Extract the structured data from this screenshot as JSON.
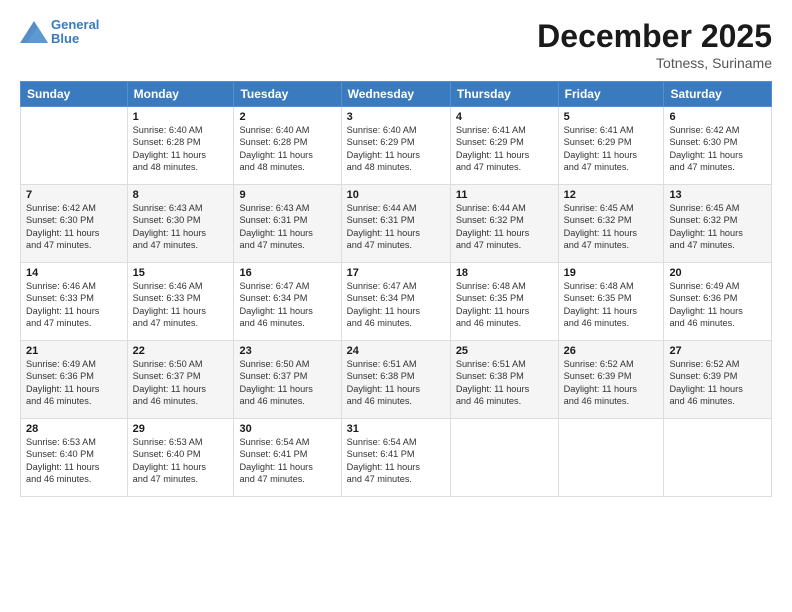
{
  "header": {
    "logo_line1": "General",
    "logo_line2": "Blue",
    "month": "December 2025",
    "location": "Totness, Suriname"
  },
  "days_of_week": [
    "Sunday",
    "Monday",
    "Tuesday",
    "Wednesday",
    "Thursday",
    "Friday",
    "Saturday"
  ],
  "weeks": [
    [
      {
        "day": "",
        "info": ""
      },
      {
        "day": "1",
        "info": "Sunrise: 6:40 AM\nSunset: 6:28 PM\nDaylight: 11 hours\nand 48 minutes."
      },
      {
        "day": "2",
        "info": "Sunrise: 6:40 AM\nSunset: 6:28 PM\nDaylight: 11 hours\nand 48 minutes."
      },
      {
        "day": "3",
        "info": "Sunrise: 6:40 AM\nSunset: 6:29 PM\nDaylight: 11 hours\nand 48 minutes."
      },
      {
        "day": "4",
        "info": "Sunrise: 6:41 AM\nSunset: 6:29 PM\nDaylight: 11 hours\nand 47 minutes."
      },
      {
        "day": "5",
        "info": "Sunrise: 6:41 AM\nSunset: 6:29 PM\nDaylight: 11 hours\nand 47 minutes."
      },
      {
        "day": "6",
        "info": "Sunrise: 6:42 AM\nSunset: 6:30 PM\nDaylight: 11 hours\nand 47 minutes."
      }
    ],
    [
      {
        "day": "7",
        "info": "Sunrise: 6:42 AM\nSunset: 6:30 PM\nDaylight: 11 hours\nand 47 minutes."
      },
      {
        "day": "8",
        "info": "Sunrise: 6:43 AM\nSunset: 6:30 PM\nDaylight: 11 hours\nand 47 minutes."
      },
      {
        "day": "9",
        "info": "Sunrise: 6:43 AM\nSunset: 6:31 PM\nDaylight: 11 hours\nand 47 minutes."
      },
      {
        "day": "10",
        "info": "Sunrise: 6:44 AM\nSunset: 6:31 PM\nDaylight: 11 hours\nand 47 minutes."
      },
      {
        "day": "11",
        "info": "Sunrise: 6:44 AM\nSunset: 6:32 PM\nDaylight: 11 hours\nand 47 minutes."
      },
      {
        "day": "12",
        "info": "Sunrise: 6:45 AM\nSunset: 6:32 PM\nDaylight: 11 hours\nand 47 minutes."
      },
      {
        "day": "13",
        "info": "Sunrise: 6:45 AM\nSunset: 6:32 PM\nDaylight: 11 hours\nand 47 minutes."
      }
    ],
    [
      {
        "day": "14",
        "info": "Sunrise: 6:46 AM\nSunset: 6:33 PM\nDaylight: 11 hours\nand 47 minutes."
      },
      {
        "day": "15",
        "info": "Sunrise: 6:46 AM\nSunset: 6:33 PM\nDaylight: 11 hours\nand 47 minutes."
      },
      {
        "day": "16",
        "info": "Sunrise: 6:47 AM\nSunset: 6:34 PM\nDaylight: 11 hours\nand 46 minutes."
      },
      {
        "day": "17",
        "info": "Sunrise: 6:47 AM\nSunset: 6:34 PM\nDaylight: 11 hours\nand 46 minutes."
      },
      {
        "day": "18",
        "info": "Sunrise: 6:48 AM\nSunset: 6:35 PM\nDaylight: 11 hours\nand 46 minutes."
      },
      {
        "day": "19",
        "info": "Sunrise: 6:48 AM\nSunset: 6:35 PM\nDaylight: 11 hours\nand 46 minutes."
      },
      {
        "day": "20",
        "info": "Sunrise: 6:49 AM\nSunset: 6:36 PM\nDaylight: 11 hours\nand 46 minutes."
      }
    ],
    [
      {
        "day": "21",
        "info": "Sunrise: 6:49 AM\nSunset: 6:36 PM\nDaylight: 11 hours\nand 46 minutes."
      },
      {
        "day": "22",
        "info": "Sunrise: 6:50 AM\nSunset: 6:37 PM\nDaylight: 11 hours\nand 46 minutes."
      },
      {
        "day": "23",
        "info": "Sunrise: 6:50 AM\nSunset: 6:37 PM\nDaylight: 11 hours\nand 46 minutes."
      },
      {
        "day": "24",
        "info": "Sunrise: 6:51 AM\nSunset: 6:38 PM\nDaylight: 11 hours\nand 46 minutes."
      },
      {
        "day": "25",
        "info": "Sunrise: 6:51 AM\nSunset: 6:38 PM\nDaylight: 11 hours\nand 46 minutes."
      },
      {
        "day": "26",
        "info": "Sunrise: 6:52 AM\nSunset: 6:39 PM\nDaylight: 11 hours\nand 46 minutes."
      },
      {
        "day": "27",
        "info": "Sunrise: 6:52 AM\nSunset: 6:39 PM\nDaylight: 11 hours\nand 46 minutes."
      }
    ],
    [
      {
        "day": "28",
        "info": "Sunrise: 6:53 AM\nSunset: 6:40 PM\nDaylight: 11 hours\nand 46 minutes."
      },
      {
        "day": "29",
        "info": "Sunrise: 6:53 AM\nSunset: 6:40 PM\nDaylight: 11 hours\nand 47 minutes."
      },
      {
        "day": "30",
        "info": "Sunrise: 6:54 AM\nSunset: 6:41 PM\nDaylight: 11 hours\nand 47 minutes."
      },
      {
        "day": "31",
        "info": "Sunrise: 6:54 AM\nSunset: 6:41 PM\nDaylight: 11 hours\nand 47 minutes."
      },
      {
        "day": "",
        "info": ""
      },
      {
        "day": "",
        "info": ""
      },
      {
        "day": "",
        "info": ""
      }
    ]
  ]
}
